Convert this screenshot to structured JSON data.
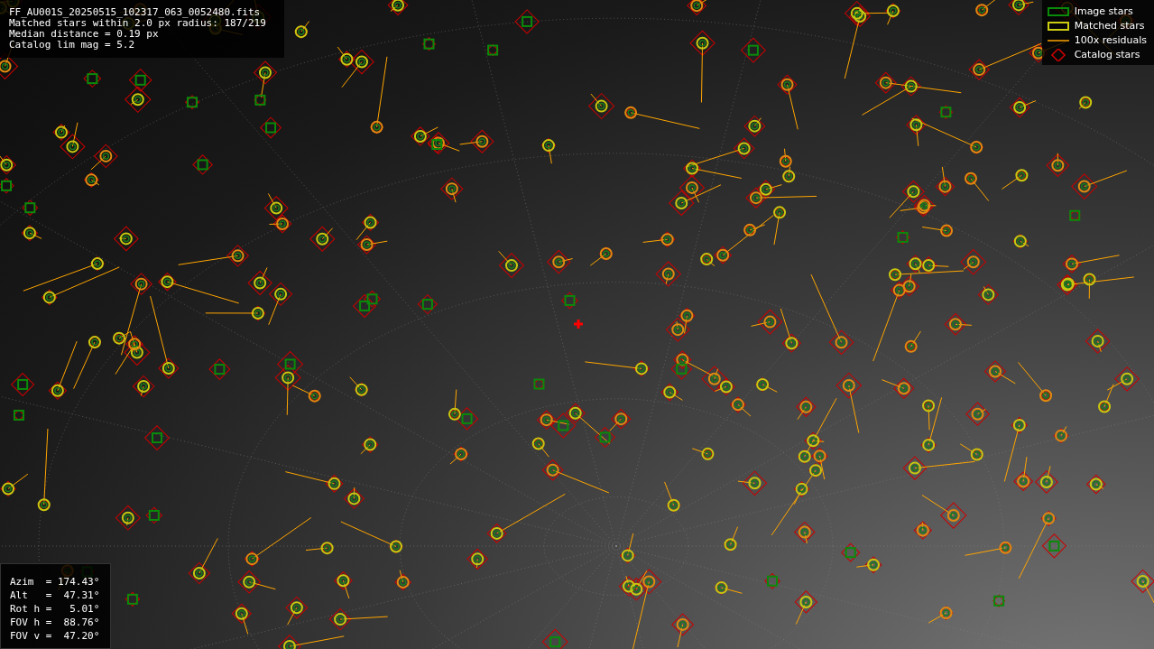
{
  "info": {
    "lines": [
      "FF_AU001S_20250515_102317_063_0052480.fits",
      "Matched stars within 2.0 px radius: 187/219",
      "Median distance = 0.19 px",
      "Catalog lim mag = 5.2"
    ]
  },
  "legend": [
    {
      "kind": "image_star",
      "label": "Image stars"
    },
    {
      "kind": "matched_star",
      "label": "Matched stars"
    },
    {
      "kind": "residual",
      "label": "100x residuals"
    },
    {
      "kind": "catalog_star",
      "label": "Catalog stars"
    }
  ],
  "pointing": {
    "lines": [
      "Azim  = 174.43°",
      "Alt   =  47.31°",
      "Rot h =   5.01°",
      "FOV h =  88.76°",
      "FOV v =  47.20°"
    ]
  }
}
